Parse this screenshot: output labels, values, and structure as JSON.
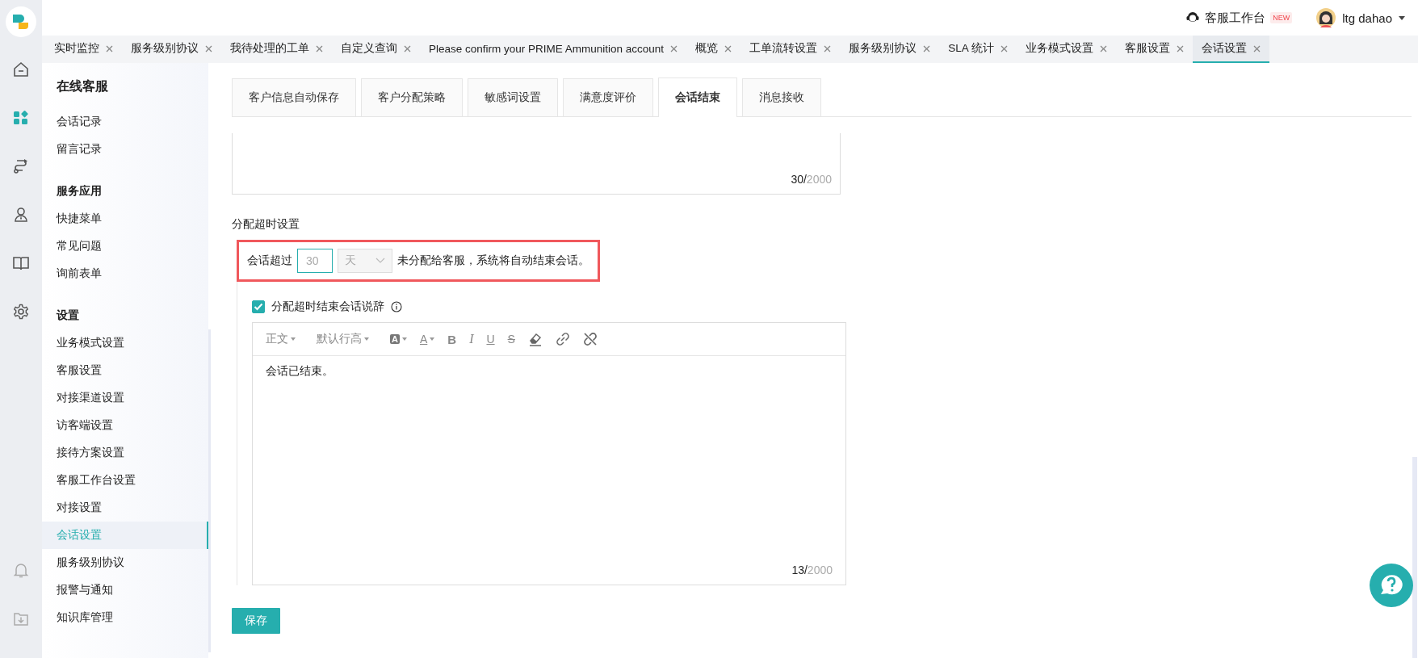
{
  "top_bar": {
    "workbench": {
      "label": "客服工作台",
      "badge": "NEW"
    },
    "user": {
      "name": "ltg dahao"
    }
  },
  "rail": [
    {
      "kind": "home",
      "selected": false
    },
    {
      "kind": "apps",
      "selected": true
    },
    {
      "kind": "flow",
      "selected": false
    },
    {
      "kind": "agent",
      "selected": false
    },
    {
      "kind": "book",
      "selected": false
    },
    {
      "kind": "settings",
      "selected": false
    }
  ],
  "rail_bottom": [
    {
      "kind": "bell"
    },
    {
      "kind": "download"
    }
  ],
  "page_tabs": [
    {
      "label": "实时监控",
      "selected": false
    },
    {
      "label": "服务级别协议",
      "selected": false
    },
    {
      "label": "我待处理的工单",
      "selected": false
    },
    {
      "label": "自定义查询",
      "selected": false
    },
    {
      "label": "Please confirm your PRIME Ammunition account",
      "selected": false
    },
    {
      "label": "概览",
      "selected": false
    },
    {
      "label": "工单流转设置",
      "selected": false
    },
    {
      "label": "服务级别协议",
      "selected": false
    },
    {
      "label": "SLA 统计",
      "selected": false
    },
    {
      "label": "业务模式设置",
      "selected": false
    },
    {
      "label": "客服设置",
      "selected": false
    },
    {
      "label": "会话设置",
      "selected": true
    }
  ],
  "sidebar": {
    "title": "在线客服",
    "groups": [
      {
        "items": [
          {
            "label": "会话记录",
            "selected": false
          },
          {
            "label": "留言记录",
            "selected": false
          }
        ]
      },
      {
        "title": "服务应用",
        "items": [
          {
            "label": "快捷菜单",
            "selected": false
          },
          {
            "label": "常见问题",
            "selected": false
          },
          {
            "label": "询前表单",
            "selected": false
          }
        ]
      },
      {
        "title": "设置",
        "items": [
          {
            "label": "业务模式设置",
            "selected": false
          },
          {
            "label": "客服设置",
            "selected": false
          },
          {
            "label": "对接渠道设置",
            "selected": false
          },
          {
            "label": "访客端设置",
            "selected": false
          },
          {
            "label": "接待方案设置",
            "selected": false
          },
          {
            "label": "客服工作台设置",
            "selected": false
          },
          {
            "label": "对接设置",
            "selected": false
          },
          {
            "label": "会话设置",
            "selected": true
          },
          {
            "label": "服务级别协议",
            "selected": false
          },
          {
            "label": "报警与通知",
            "selected": false
          },
          {
            "label": "知识库管理",
            "selected": false
          }
        ]
      }
    ]
  },
  "settings_tabs": [
    {
      "label": "客户信息自动保存",
      "selected": false
    },
    {
      "label": "客户分配策略",
      "selected": false
    },
    {
      "label": "敏感词设置",
      "selected": false
    },
    {
      "label": "满意度评价",
      "selected": false
    },
    {
      "label": "会话结束",
      "selected": true
    },
    {
      "label": "消息接收",
      "selected": false
    }
  ],
  "upper_editor": {
    "count": "30/",
    "limit": "2000"
  },
  "timeout": {
    "title": "分配超时设置",
    "prefix": "会话超过",
    "value": "30",
    "unit": "天",
    "unit_disabled": true,
    "suffix": "未分配给客服，系统将自动结束会话。",
    "highlighted": true
  },
  "message": {
    "checked": true,
    "label": "分配超时结束会话说辞",
    "toolbar": [
      {
        "kind": "dropdown",
        "label": "正文"
      },
      {
        "kind": "dropdown",
        "label": "默认行高"
      },
      {
        "kind": "bg_color",
        "label": "A"
      },
      {
        "kind": "font_color",
        "label": "A"
      },
      {
        "kind": "bold",
        "label": "B"
      },
      {
        "kind": "italic",
        "label": "I"
      },
      {
        "kind": "underline",
        "label": "U"
      },
      {
        "kind": "strike",
        "label": "S"
      },
      {
        "kind": "eraser"
      },
      {
        "kind": "link"
      },
      {
        "kind": "unlink"
      }
    ],
    "content": "会话已结束。",
    "count": "13/",
    "limit": "2000"
  },
  "save_button": "保存"
}
